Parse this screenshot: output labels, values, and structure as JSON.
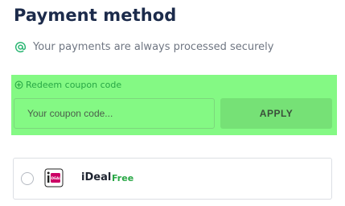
{
  "page": {
    "title": "Payment method",
    "secure_note": "Your payments are always processed securely"
  },
  "coupon": {
    "toggle_label": "Redeem coupon code",
    "input_placeholder": "Your coupon code...",
    "input_value": "",
    "apply_label": "APPLY"
  },
  "payment_methods": [
    {
      "name": "iDeal",
      "price_label": "Free",
      "selected": false,
      "icon": "ideal-logo"
    }
  ],
  "colors": {
    "title": "#1c2b4b",
    "accent_green": "#28a745",
    "coupon_highlight": "#84f984",
    "ideal_brand": "#cc0066"
  },
  "icons": {
    "secure": "at-sign-icon",
    "redeem": "plus-circle-icon"
  }
}
